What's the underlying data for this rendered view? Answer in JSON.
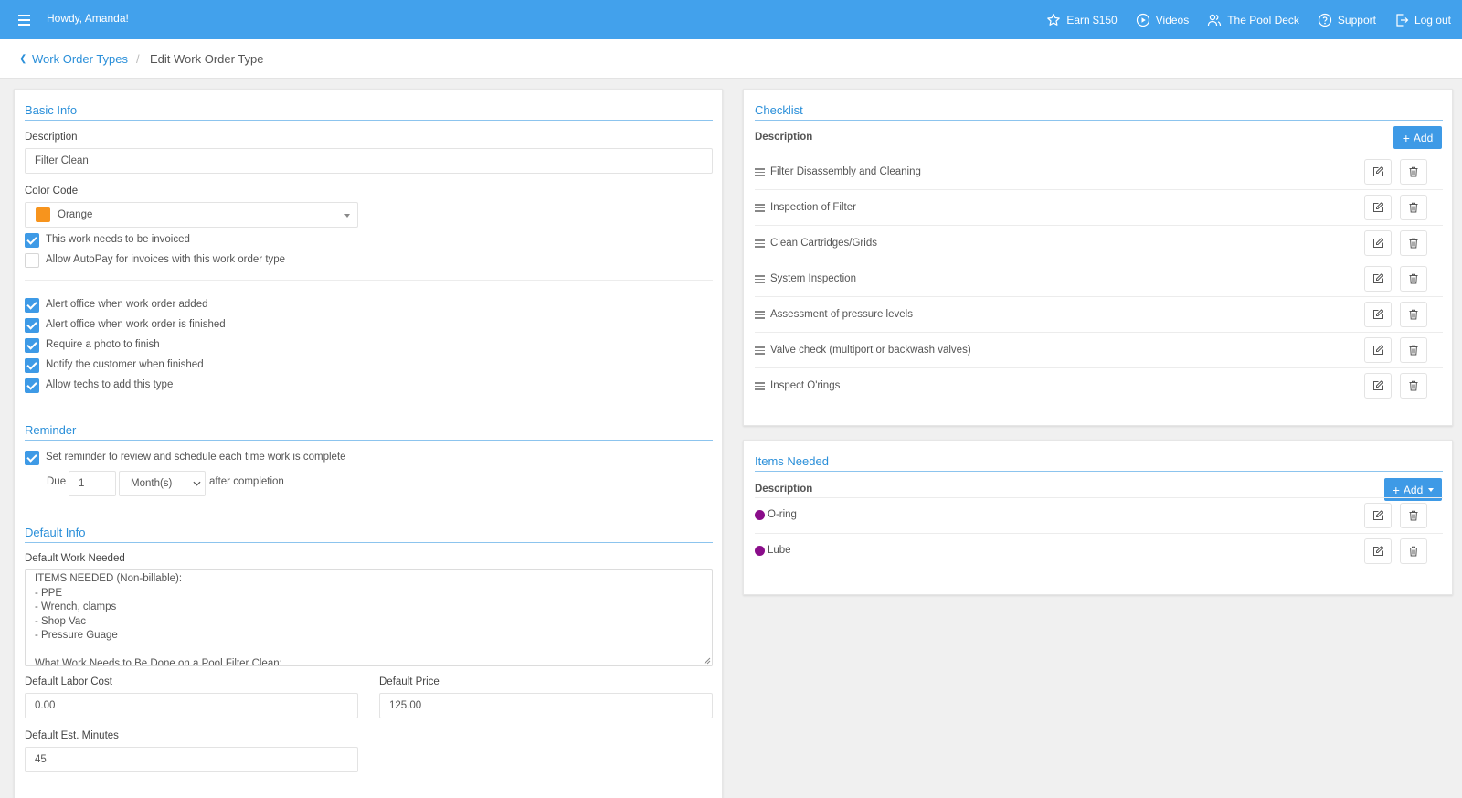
{
  "topbar": {
    "greeting": "Howdy, Amanda!",
    "links": [
      {
        "label": "Earn $150",
        "icon": "star-icon"
      },
      {
        "label": "Videos",
        "icon": "play-circle-icon"
      },
      {
        "label": "The Pool Deck",
        "icon": "users-icon"
      },
      {
        "label": "Support",
        "icon": "question-circle-icon"
      },
      {
        "label": "Log out",
        "icon": "logout-icon"
      }
    ],
    "color": "#42a1ec"
  },
  "breadcrumb": {
    "parent": "Work Order Types",
    "separator": "/",
    "current": "Edit Work Order Type"
  },
  "basic_info": {
    "title": "Basic Info",
    "description_label": "Description",
    "description_value": "Filter Clean",
    "color_label": "Color Code",
    "color_value": "Orange",
    "color_hex": "#f7941d",
    "invoice": {
      "label": "This work needs to be invoiced",
      "checked": true
    },
    "autopay": {
      "label": "Allow AutoPay for invoices with this work order type",
      "checked": false
    },
    "options": [
      {
        "label": "Alert office when work order added",
        "checked": true
      },
      {
        "label": "Alert office when work order is finished",
        "checked": true
      },
      {
        "label": "Require a photo to finish",
        "checked": true
      },
      {
        "label": "Notify the customer when finished",
        "checked": true
      },
      {
        "label": "Allow techs to add this type",
        "checked": true
      }
    ]
  },
  "reminder": {
    "title": "Reminder",
    "checkbox_label": "Set reminder to review and schedule each time work is complete",
    "checked": true,
    "due_label": "Due",
    "due_value": "1",
    "unit": "Month(s)",
    "after_label": "after completion"
  },
  "default_info": {
    "title": "Default Info",
    "work_needed_label": "Default Work Needed",
    "work_needed_text": "ITEMS NEEDED (Non-billable):\n- PPE\n- Wrench, clamps\n- Shop Vac\n- Pressure Guage\n\nWhat Work Needs to Be Done on a Pool Filter Clean:",
    "labor_cost_label": "Default Labor Cost",
    "labor_cost_value": "0.00",
    "price_label": "Default Price",
    "price_value": "125.00",
    "minutes_label": "Default Est. Minutes",
    "minutes_value": "45"
  },
  "checklist": {
    "title": "Checklist",
    "column": "Description",
    "add_label": "Add",
    "items": [
      "Filter Disassembly and Cleaning",
      "Inspection of Filter",
      "Clean Cartridges/Grids",
      "System Inspection",
      "Assessment of pressure levels",
      "Valve check (multiport or backwash valves)",
      "Inspect O'rings"
    ]
  },
  "items_needed": {
    "title": "Items Needed",
    "column": "Description",
    "add_label": "Add",
    "dot_color": "#8a0d8a",
    "items": [
      "O-ring",
      "Lube"
    ]
  }
}
